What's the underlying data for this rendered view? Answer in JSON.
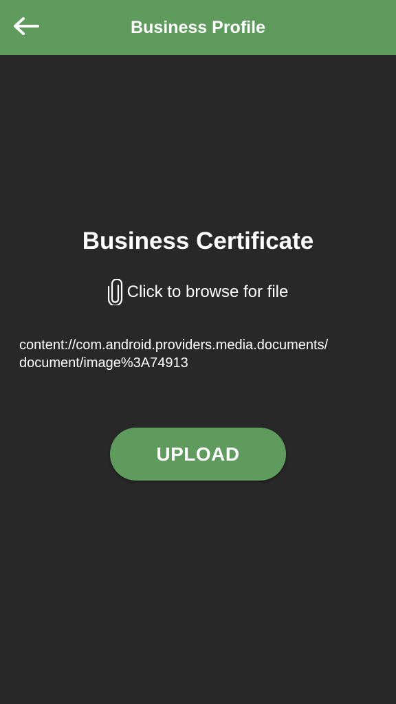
{
  "app_bar": {
    "title": "Business Profile",
    "back_icon": "arrow-left-icon",
    "color": "#5e9b5d"
  },
  "main": {
    "section_title": "Business Certificate",
    "browse": {
      "icon": "paperclip-icon",
      "label": "Click to browse for file"
    },
    "file_path": {
      "line1": "content://com.android.providers.media.documents/",
      "line2": "document/image%3A74913"
    },
    "upload_button": {
      "label": "UPLOAD",
      "color": "#5e9b5d"
    },
    "background": "#282828"
  }
}
